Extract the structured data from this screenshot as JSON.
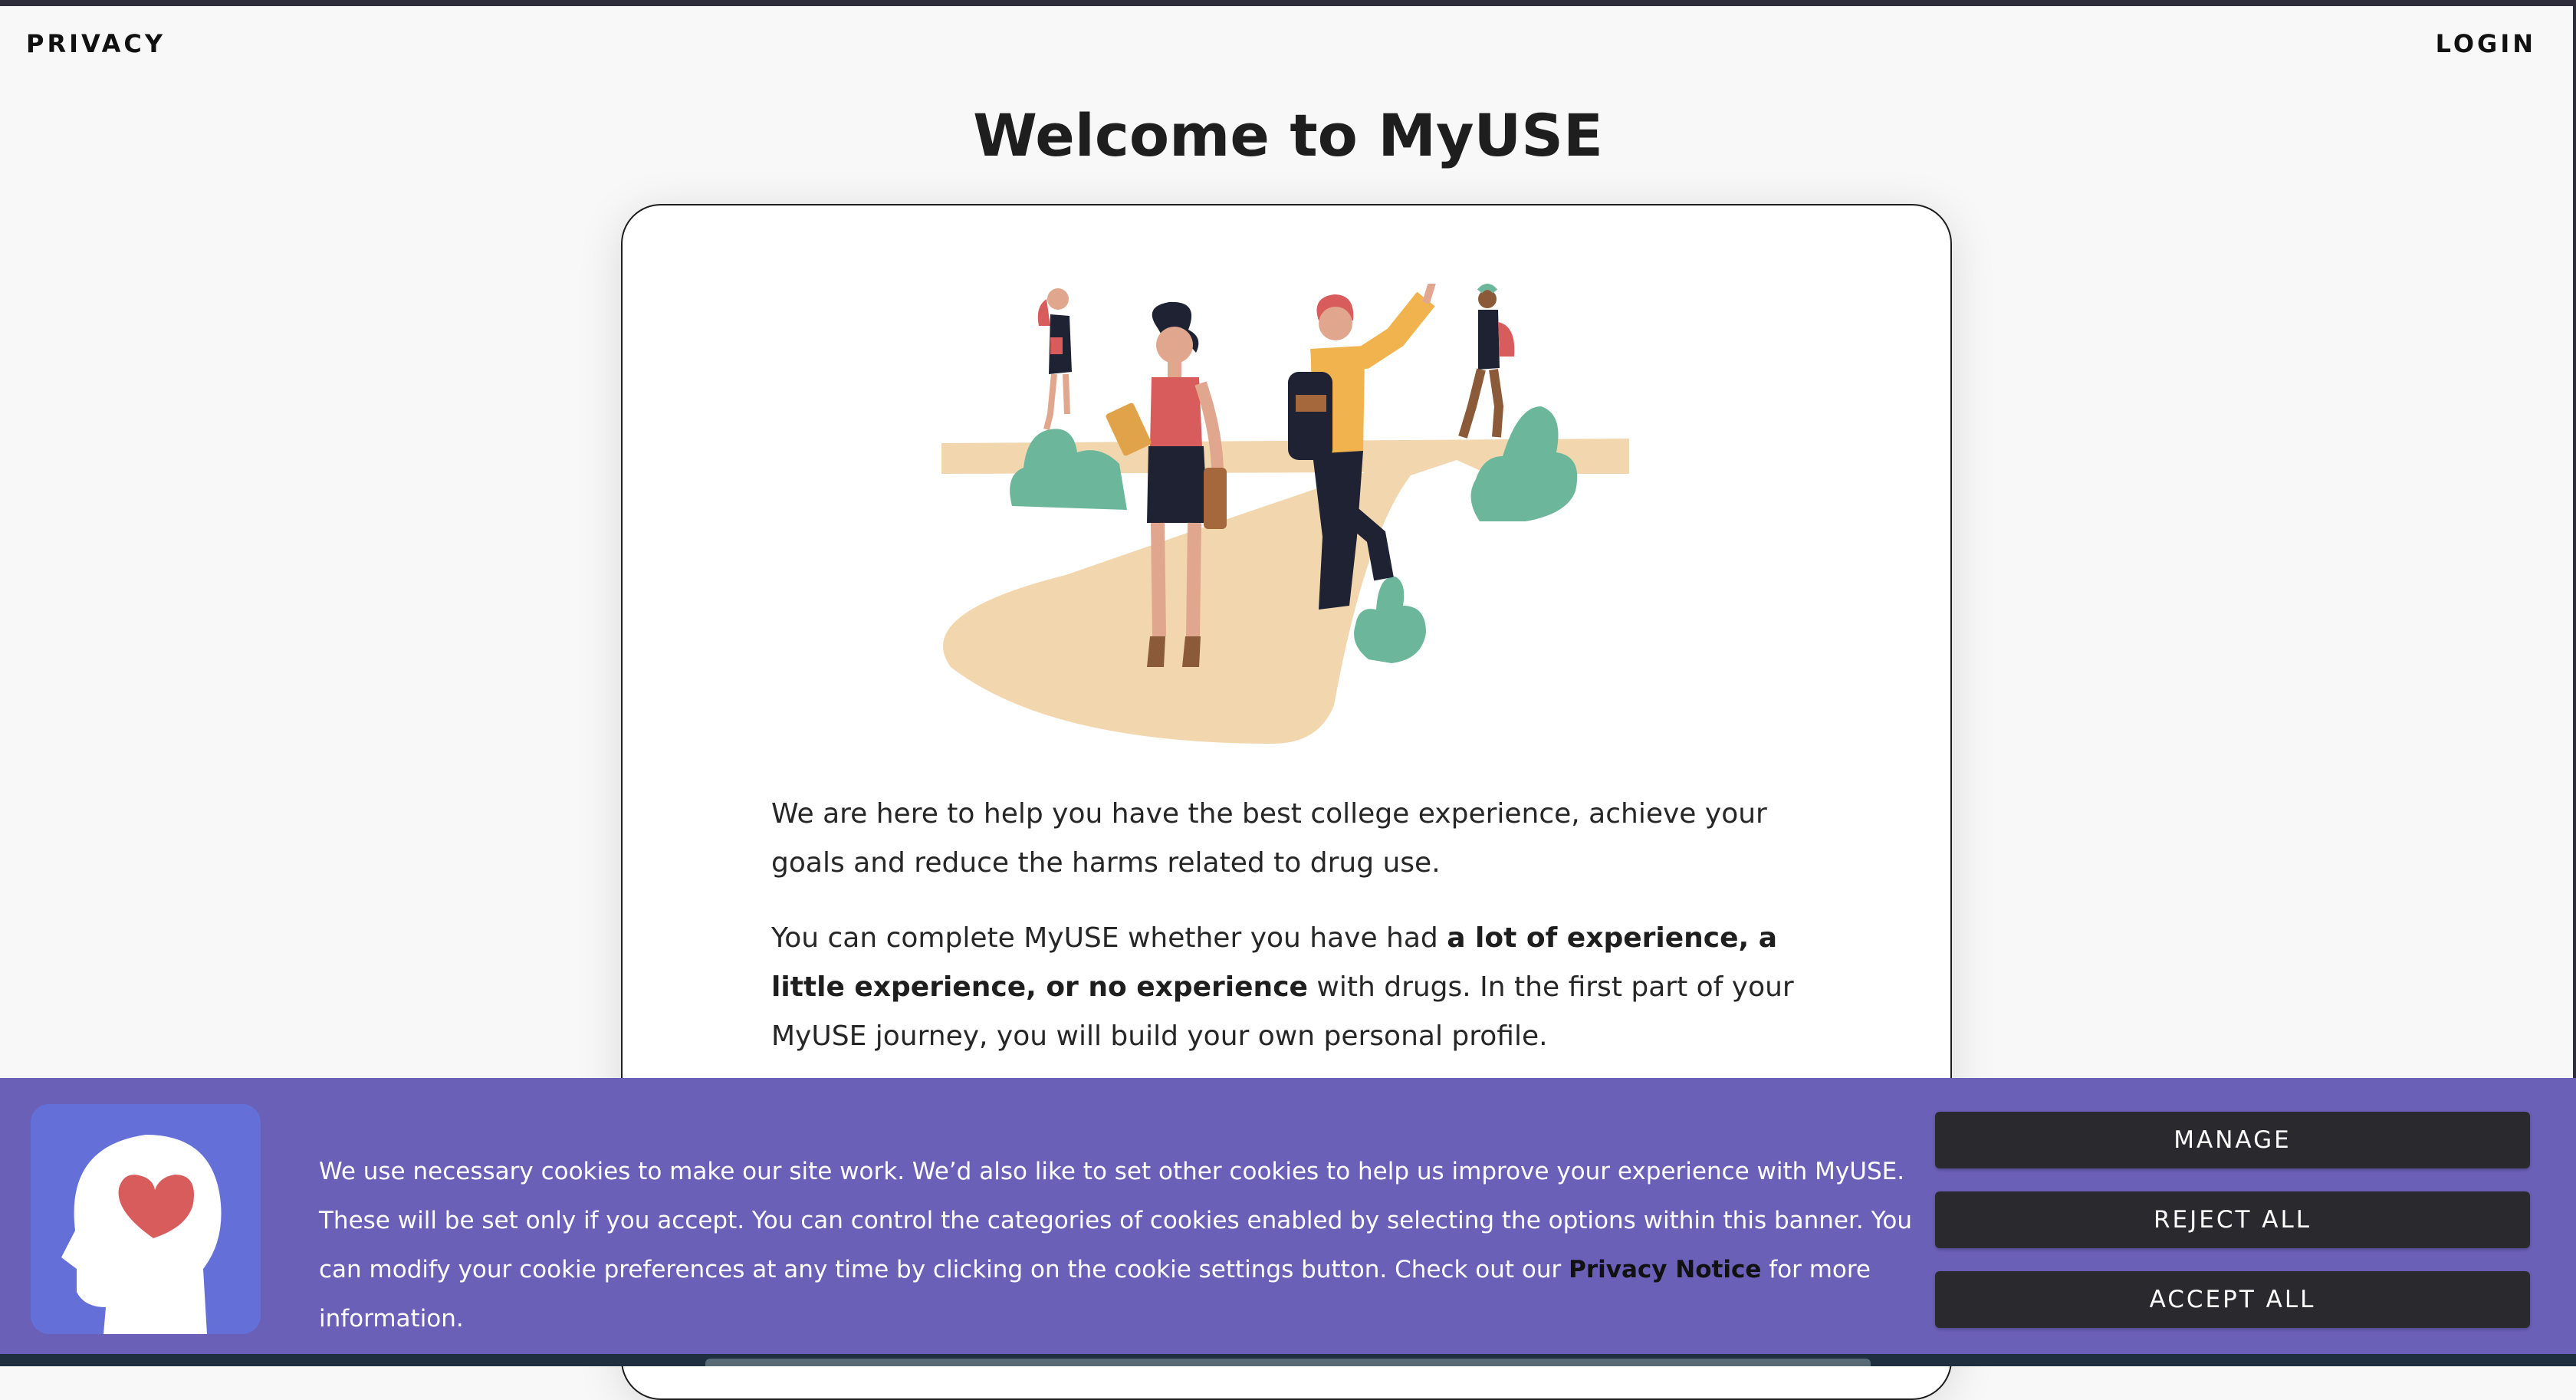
{
  "header": {
    "privacy_label": "PRIVACY",
    "login_label": "LOGIN"
  },
  "page": {
    "title": "Welcome to MyUSE"
  },
  "intro": {
    "p1": "We are here to help you have the best college experience, achieve your goals and reduce the harms related to drug use.",
    "p2_before": "You can complete MyUSE whether you have had ",
    "p2_bold": "a lot of experience, a little experience, or no experience",
    "p2_after": " with drugs. In the first part of your MyUSE journey, you will build your own personal profile."
  },
  "cookie_banner": {
    "text_before": "We use necessary cookies to make our site work. We’d also like to set other cookies to help us improve your experience with MyUSE. These will be set only if you accept. You can control the categories of cookies enabled by selecting the options within this banner. You can modify your cookie preferences at any time by clicking on the cookie settings button. Check out our ",
    "privacy_link": "Privacy Notice",
    "text_after": " for more information.",
    "manage_label": "MANAGE",
    "reject_label": "REJECT ALL",
    "accept_label": "ACCEPT ALL",
    "logo_icon": "head-heart-icon"
  },
  "colors": {
    "banner_bg": "#6b60b8",
    "logo_bg": "#6470d8",
    "button_bg": "#2a2a2e",
    "path_sand": "#f2d6ae",
    "bush_green": "#6cb79c",
    "heart_red": "#d95c5c"
  }
}
